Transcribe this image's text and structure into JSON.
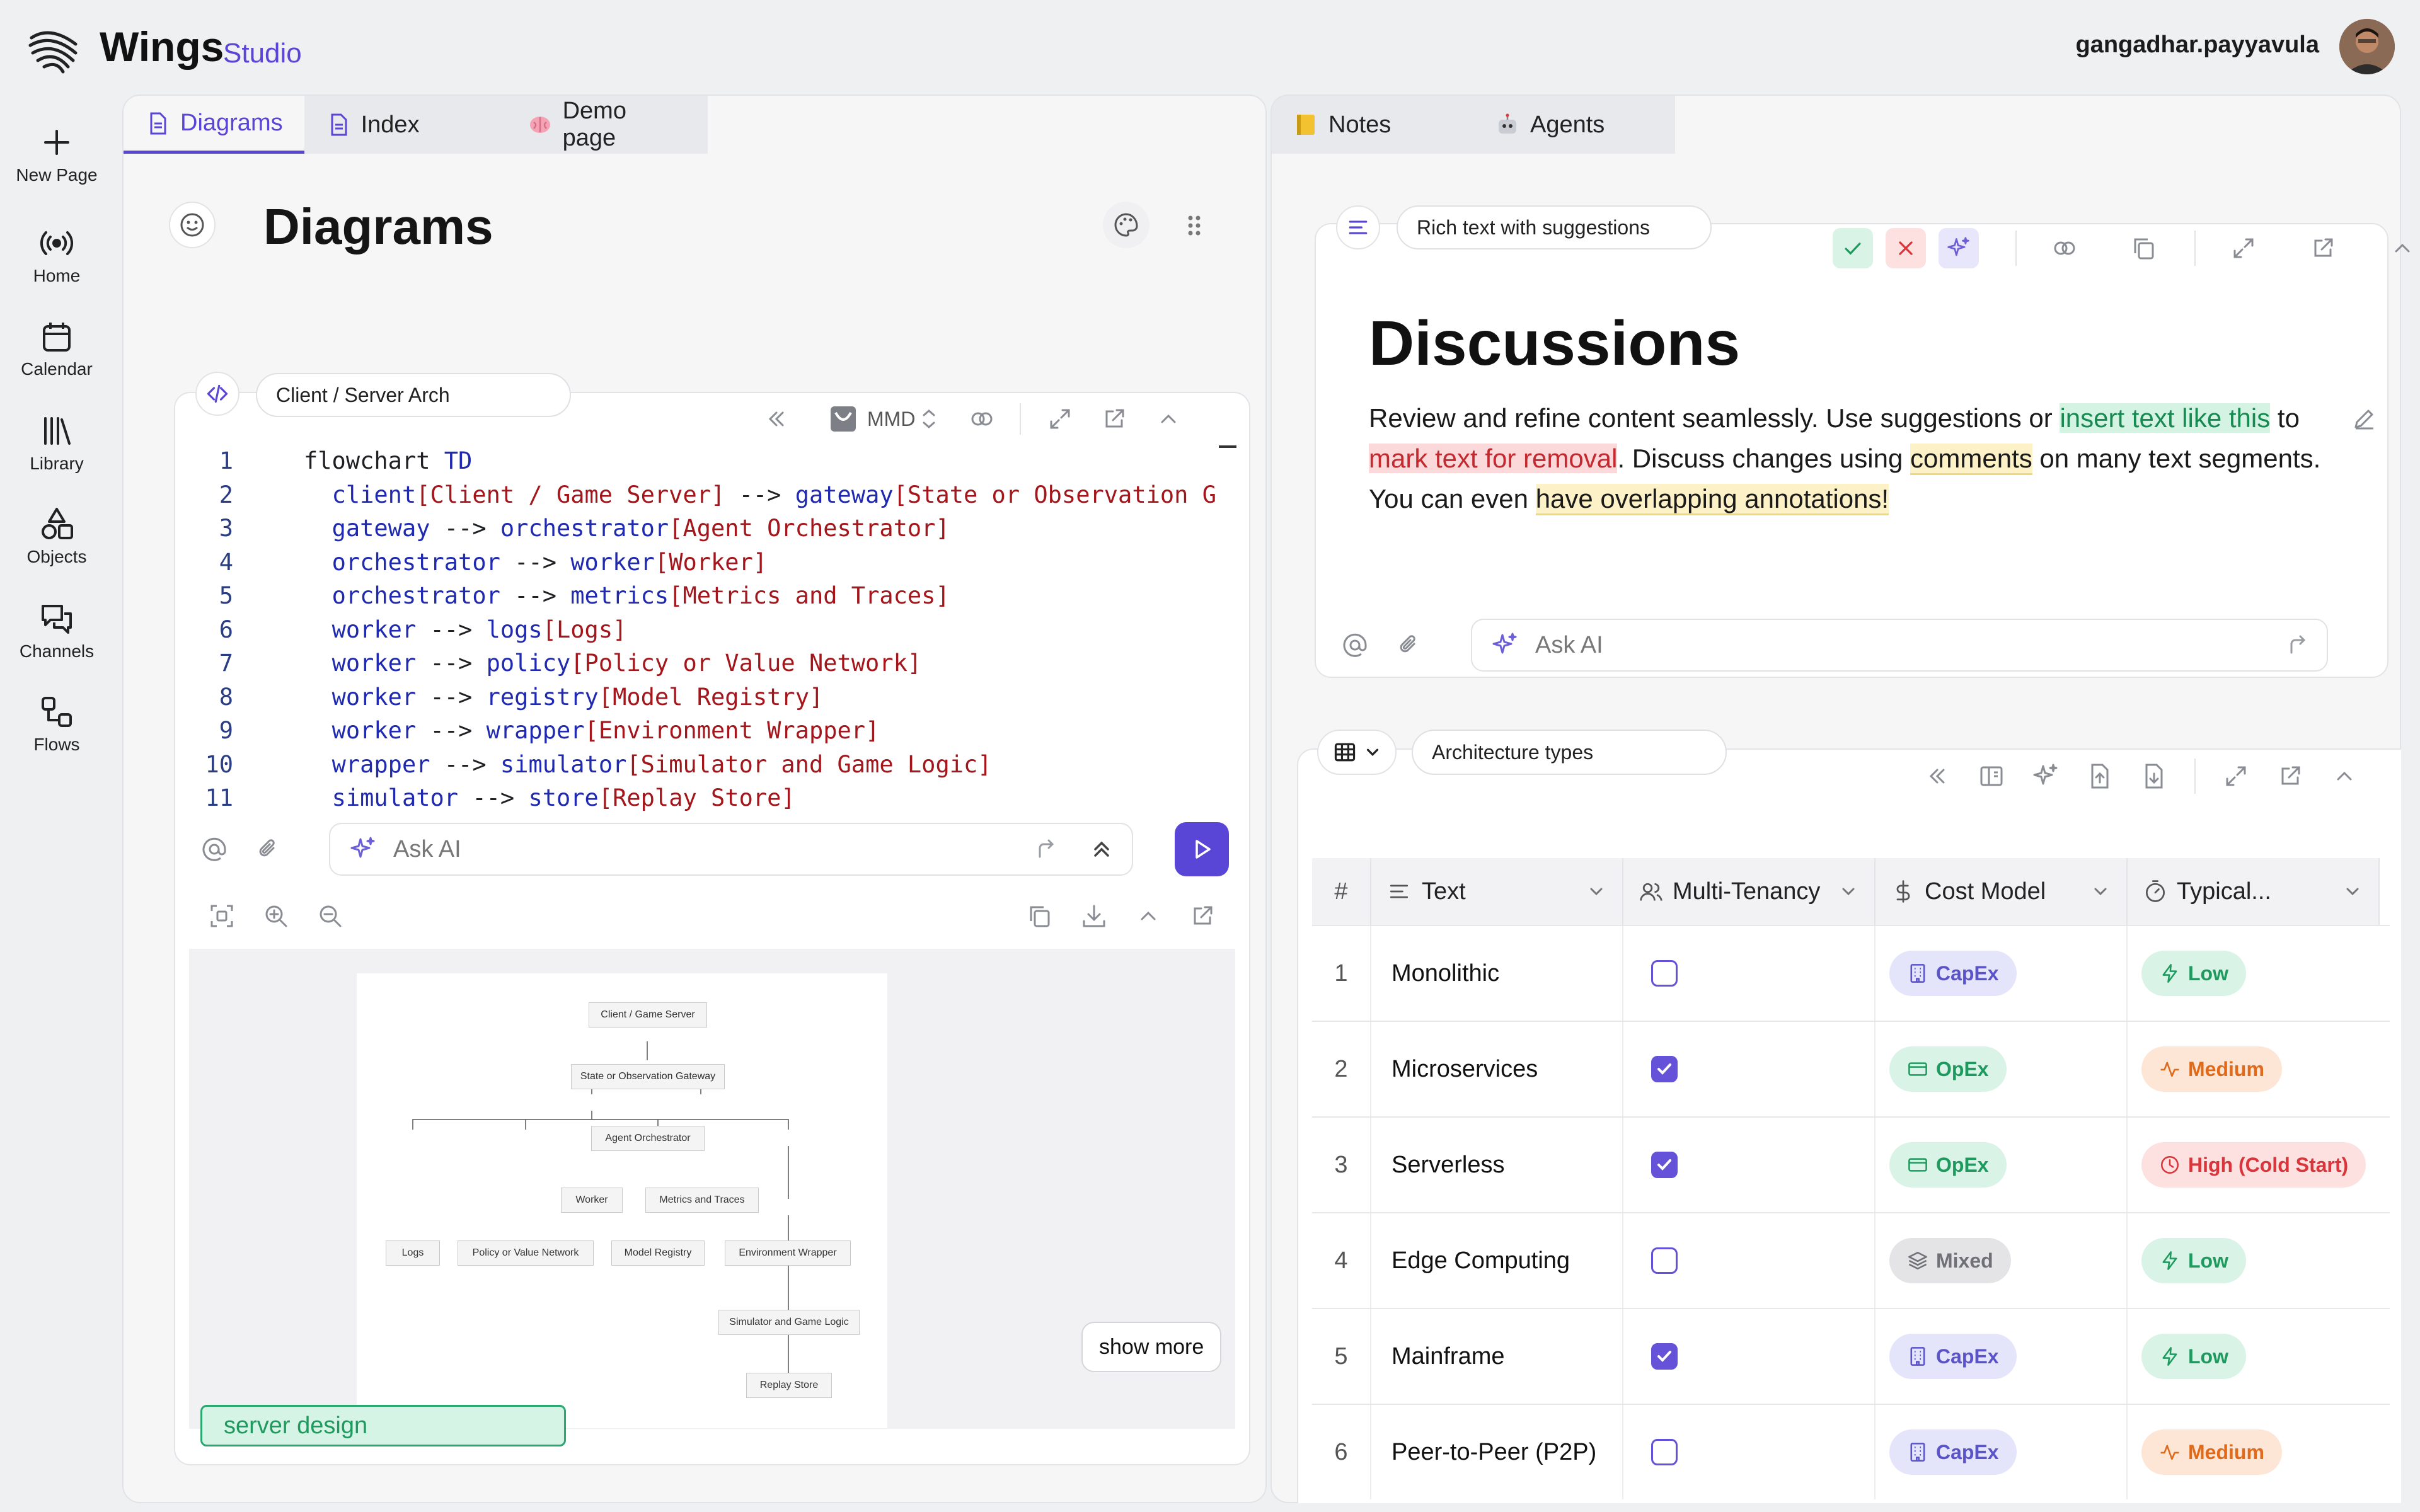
{
  "app": {
    "brand": "Wings",
    "brand_sub": "Studio",
    "user": "gangadhar.payyavula"
  },
  "rail": [
    {
      "label": "New Page",
      "icon": "plus-icon"
    },
    {
      "label": "Home",
      "icon": "broadcast-icon"
    },
    {
      "label": "Calendar",
      "icon": "calendar-icon"
    },
    {
      "label": "Library",
      "icon": "library-icon"
    },
    {
      "label": "Objects",
      "icon": "shapes-icon"
    },
    {
      "label": "Channels",
      "icon": "chat-icon"
    },
    {
      "label": "Flows",
      "icon": "flow-icon"
    }
  ],
  "left_tabs": [
    {
      "label": "Diagrams",
      "icon": "document-icon",
      "active": true
    },
    {
      "label": "Index",
      "icon": "document-icon"
    },
    {
      "label": "Demo page",
      "icon": "brain-emoji"
    }
  ],
  "right_tabs": [
    {
      "label": "Notes",
      "icon": "notebook-emoji"
    },
    {
      "label": "Agents",
      "icon": "robot-emoji"
    }
  ],
  "page": {
    "title": "Diagrams"
  },
  "code_block": {
    "name": "Client / Server Arch",
    "lang": "MMD",
    "lines": [
      {
        "n": "1",
        "indent": "",
        "parts": [
          [
            "t",
            "flowchart "
          ],
          [
            "kw",
            "TD"
          ]
        ]
      },
      {
        "n": "2",
        "indent": "  ",
        "parts": [
          [
            "kw",
            "client"
          ],
          [
            "str",
            "[Client / Game Server]"
          ],
          [
            "t",
            " --> "
          ],
          [
            "kw",
            "gateway"
          ],
          [
            "str",
            "[State or Observation G"
          ]
        ]
      },
      {
        "n": "3",
        "indent": "  ",
        "parts": [
          [
            "kw",
            "gateway"
          ],
          [
            "t",
            " --> "
          ],
          [
            "kw",
            "orchestrator"
          ],
          [
            "str",
            "[Agent Orchestrator]"
          ]
        ]
      },
      {
        "n": "4",
        "indent": "  ",
        "parts": [
          [
            "kw",
            "orchestrator"
          ],
          [
            "t",
            " --> "
          ],
          [
            "kw",
            "worker"
          ],
          [
            "str",
            "[Worker]"
          ]
        ]
      },
      {
        "n": "5",
        "indent": "  ",
        "parts": [
          [
            "kw",
            "orchestrator"
          ],
          [
            "t",
            " --> "
          ],
          [
            "kw",
            "metrics"
          ],
          [
            "str",
            "[Metrics and Traces]"
          ]
        ]
      },
      {
        "n": "6",
        "indent": "  ",
        "parts": [
          [
            "kw",
            "worker"
          ],
          [
            "t",
            " --> "
          ],
          [
            "kw",
            "logs"
          ],
          [
            "str",
            "[Logs]"
          ]
        ]
      },
      {
        "n": "7",
        "indent": "  ",
        "parts": [
          [
            "kw",
            "worker"
          ],
          [
            "t",
            " --> "
          ],
          [
            "kw",
            "policy"
          ],
          [
            "str",
            "[Policy or Value Network]"
          ]
        ]
      },
      {
        "n": "8",
        "indent": "  ",
        "parts": [
          [
            "kw",
            "worker"
          ],
          [
            "t",
            " --> "
          ],
          [
            "kw",
            "registry"
          ],
          [
            "str",
            "[Model Registry]"
          ]
        ]
      },
      {
        "n": "9",
        "indent": "  ",
        "parts": [
          [
            "kw",
            "worker"
          ],
          [
            "t",
            " --> "
          ],
          [
            "kw",
            "wrapper"
          ],
          [
            "str",
            "[Environment Wrapper]"
          ]
        ]
      },
      {
        "n": "10",
        "indent": "  ",
        "parts": [
          [
            "kw",
            "wrapper"
          ],
          [
            "t",
            " --> "
          ],
          [
            "kw",
            "simulator"
          ],
          [
            "str",
            "[Simulator and Game Logic]"
          ]
        ]
      },
      {
        "n": "11",
        "indent": "  ",
        "parts": [
          [
            "kw",
            "simulator"
          ],
          [
            "t",
            " --> "
          ],
          [
            "kw",
            "store"
          ],
          [
            "str",
            "[Replay Store]"
          ]
        ]
      }
    ],
    "ask_placeholder": "Ask AI",
    "diagram_nodes": [
      "Client / Game Server",
      "State or Observation Gateway",
      "Agent Orchestrator",
      "Worker",
      "Metrics and Traces",
      "Logs",
      "Policy or Value Network",
      "Model Registry",
      "Environment Wrapper",
      "Simulator and Game Logic",
      "Replay Store"
    ],
    "show_more": "show more",
    "tag": "server design"
  },
  "rich_text": {
    "name": "Rich text with suggestions",
    "heading": "Discussions",
    "segments": [
      {
        "t": "Review and refine content seamlessly. Use suggestions or ",
        "s": "plain"
      },
      {
        "t": "insert text like this",
        "s": "insert"
      },
      {
        "t": " to ",
        "s": "plain"
      },
      {
        "t": "mark text for removal",
        "s": "remove"
      },
      {
        "t": ". Discuss changes using ",
        "s": "plain"
      },
      {
        "t": "comments",
        "s": "comment"
      },
      {
        "t": " on many text segments. You can even ",
        "s": "plain"
      },
      {
        "t": "have overlapping annotations!",
        "s": "comment"
      }
    ],
    "ask_placeholder": "Ask AI"
  },
  "table": {
    "name": "Architecture types",
    "columns": [
      "#",
      "Text",
      "Multi-Tenancy",
      "Cost Model",
      "Typical..."
    ],
    "rows": [
      {
        "n": "1",
        "text": "Monolithic",
        "multi": false,
        "cost": "CapEx",
        "typ": "Low"
      },
      {
        "n": "2",
        "text": "Microservices",
        "multi": true,
        "cost": "OpEx",
        "typ": "Medium"
      },
      {
        "n": "3",
        "text": "Serverless",
        "multi": true,
        "cost": "OpEx",
        "typ": "High (Cold Start)"
      },
      {
        "n": "4",
        "text": "Edge Computing",
        "multi": false,
        "cost": "Mixed",
        "typ": "Low"
      },
      {
        "n": "5",
        "text": "Mainframe",
        "multi": true,
        "cost": "CapEx",
        "typ": "Low"
      },
      {
        "n": "6",
        "text": "Peer-to-Peer (P2P)",
        "multi": false,
        "cost": "CapEx",
        "typ": "Medium"
      }
    ]
  },
  "colors": {
    "accent": "#5a46d6",
    "insert_bg": "#d5f3e3",
    "remove_bg": "#fbd9da",
    "comment_bg": "#fcf1c7"
  }
}
